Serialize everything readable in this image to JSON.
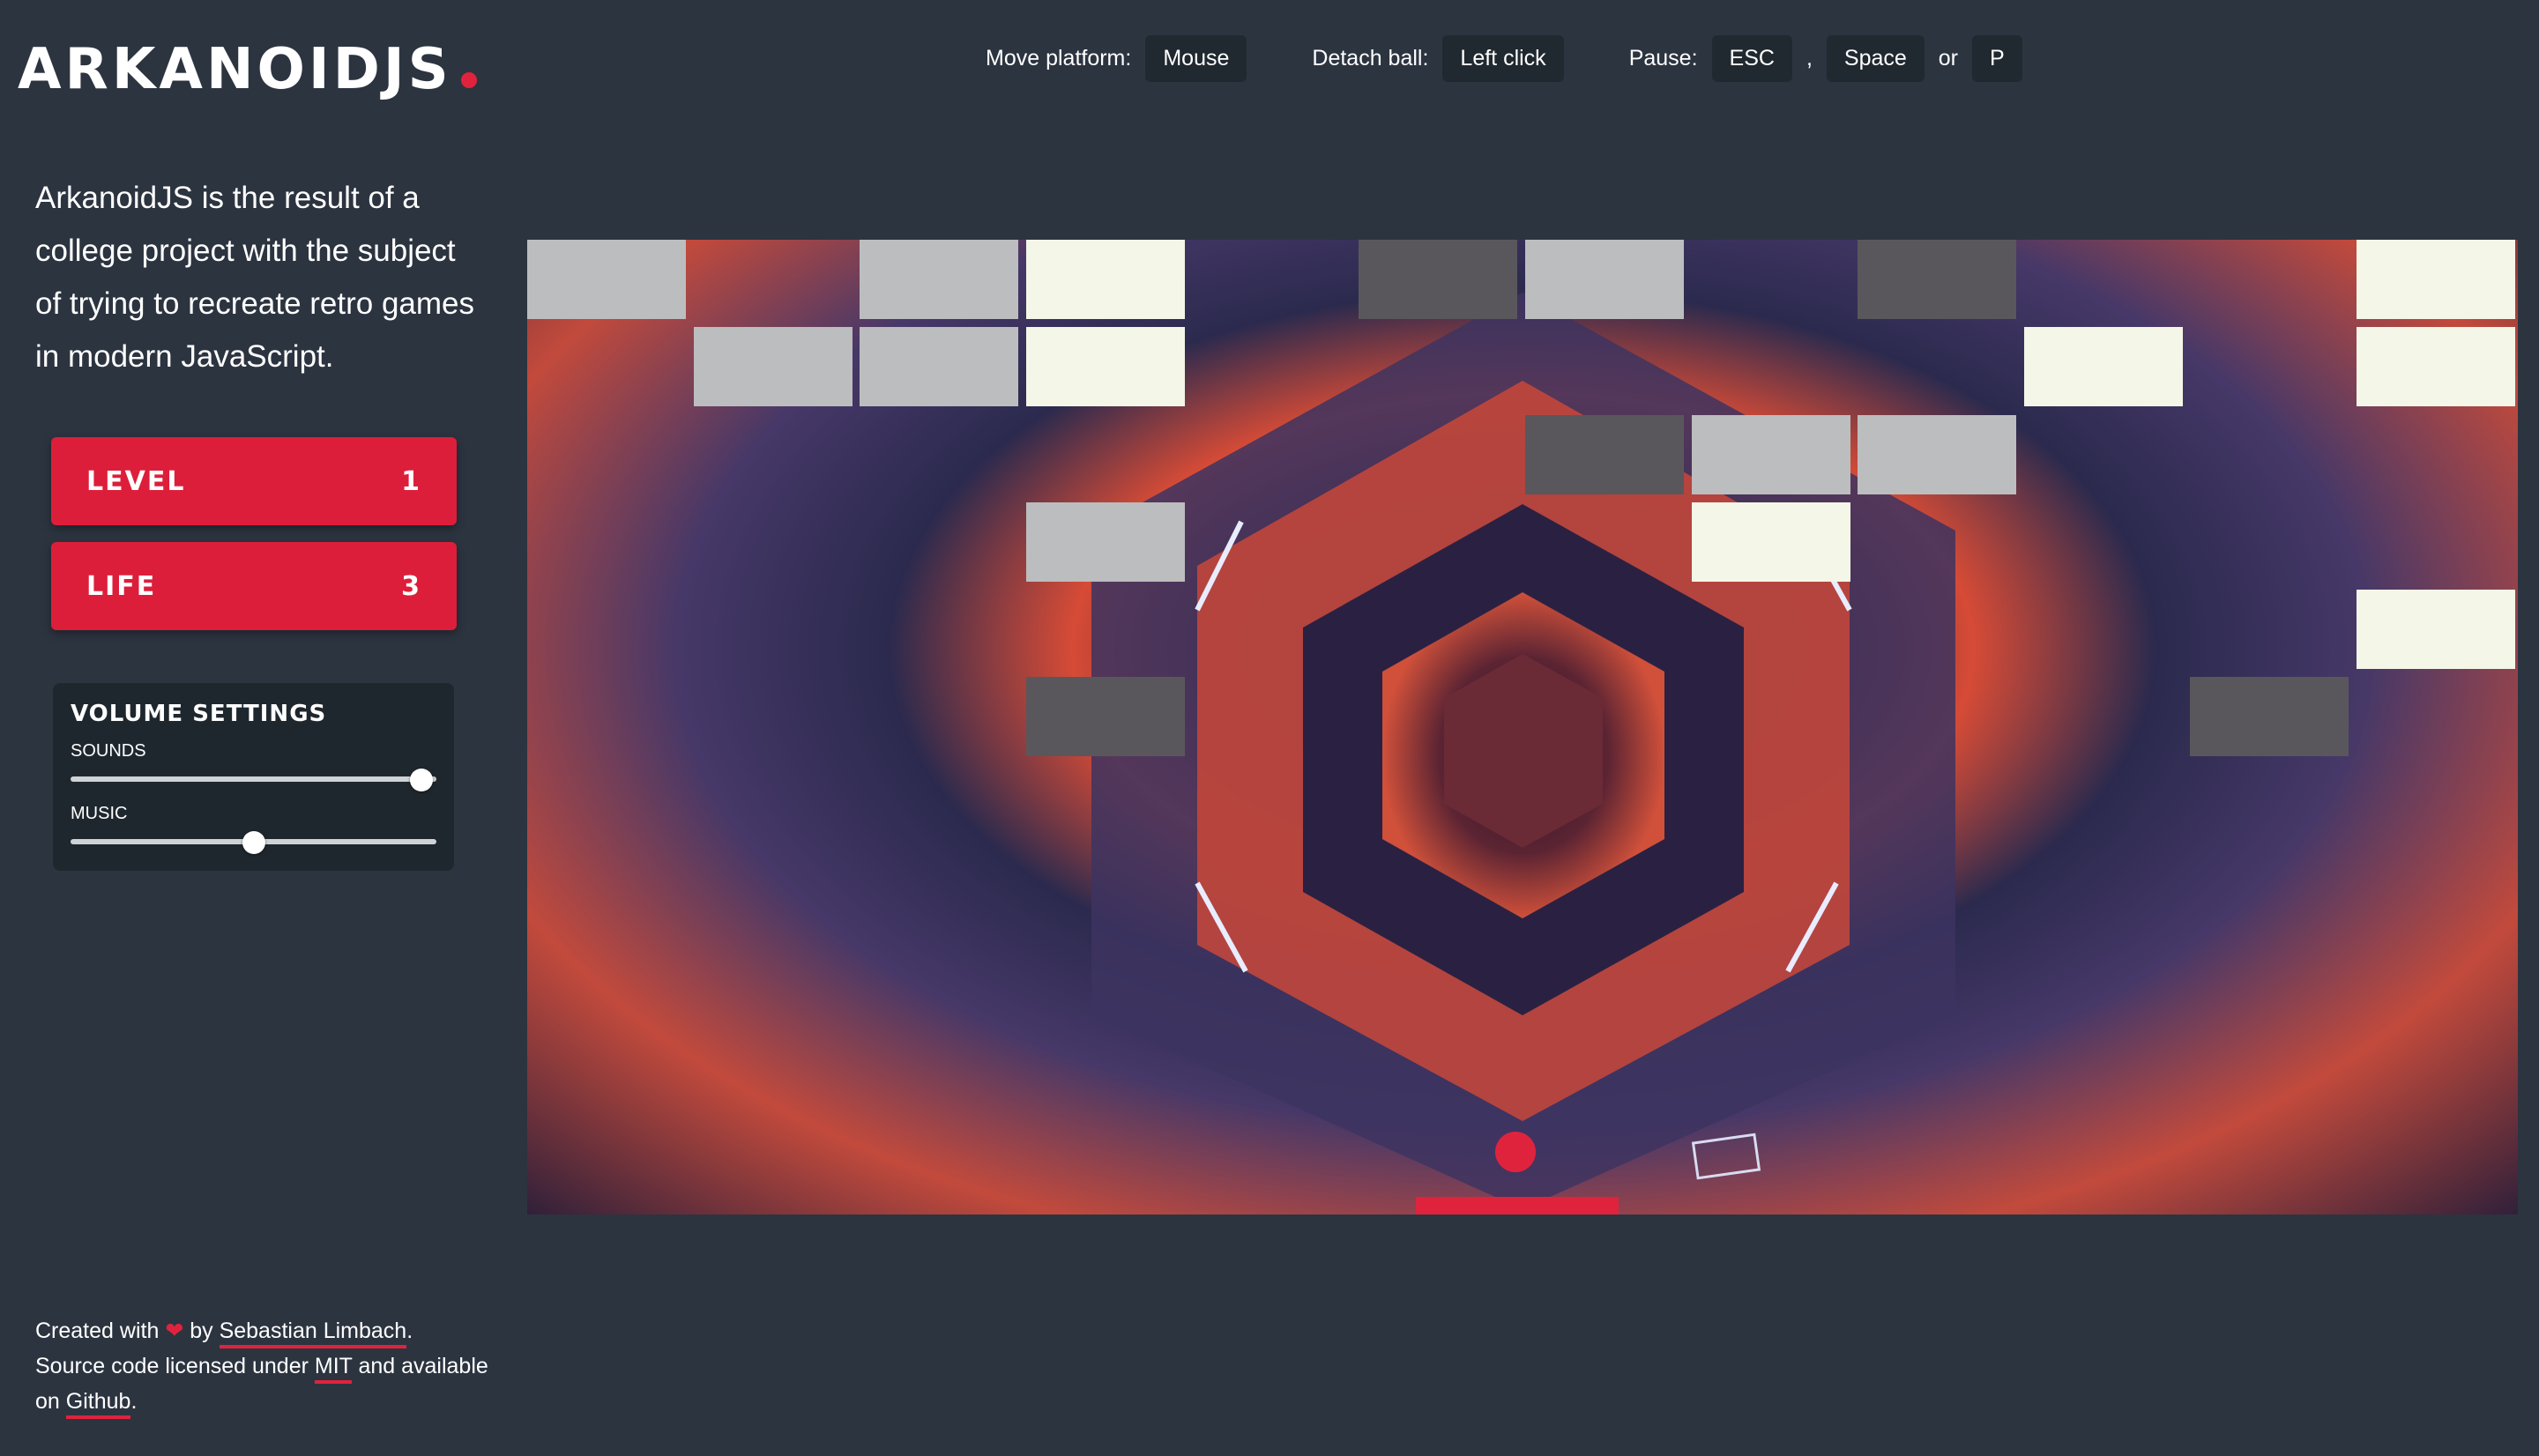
{
  "app": {
    "logo": "ARKANOIDJS"
  },
  "controls": {
    "move_label": "Move platform:",
    "move_key": "Mouse",
    "detach_label": "Detach ball:",
    "detach_key": "Left click",
    "pause_label": "Pause:",
    "pause_keys": [
      "ESC",
      "Space",
      "P"
    ],
    "comma": ",",
    "or": "or"
  },
  "description": "ArkanoidJS is the result of a college project with the subject of trying to recreate retro games in modern JavaScript.",
  "stats": {
    "level_label": "LEVEL",
    "level_value": "1",
    "life_label": "LIFE",
    "life_value": "3"
  },
  "volume": {
    "title": "VOLUME SETTINGS",
    "sounds_label": "SOUNDS",
    "sounds_level": 0.96,
    "music_label": "MUSIC",
    "music_level": 0.5
  },
  "footer": {
    "created_with": "Created with",
    "heart": "❤",
    "by": "by",
    "author": "Sebastian Limbach",
    "line2_prefix": "Source code licensed under",
    "license": "MIT",
    "line2_suffix": "and available",
    "line3_prefix": "on",
    "github": "Github"
  },
  "colors": {
    "background": "#2c3440",
    "accent": "#e0233d",
    "brick_light": "#bcbdbe",
    "brick_cream": "#f4f6e7",
    "brick_dark": "#5a575c"
  }
}
